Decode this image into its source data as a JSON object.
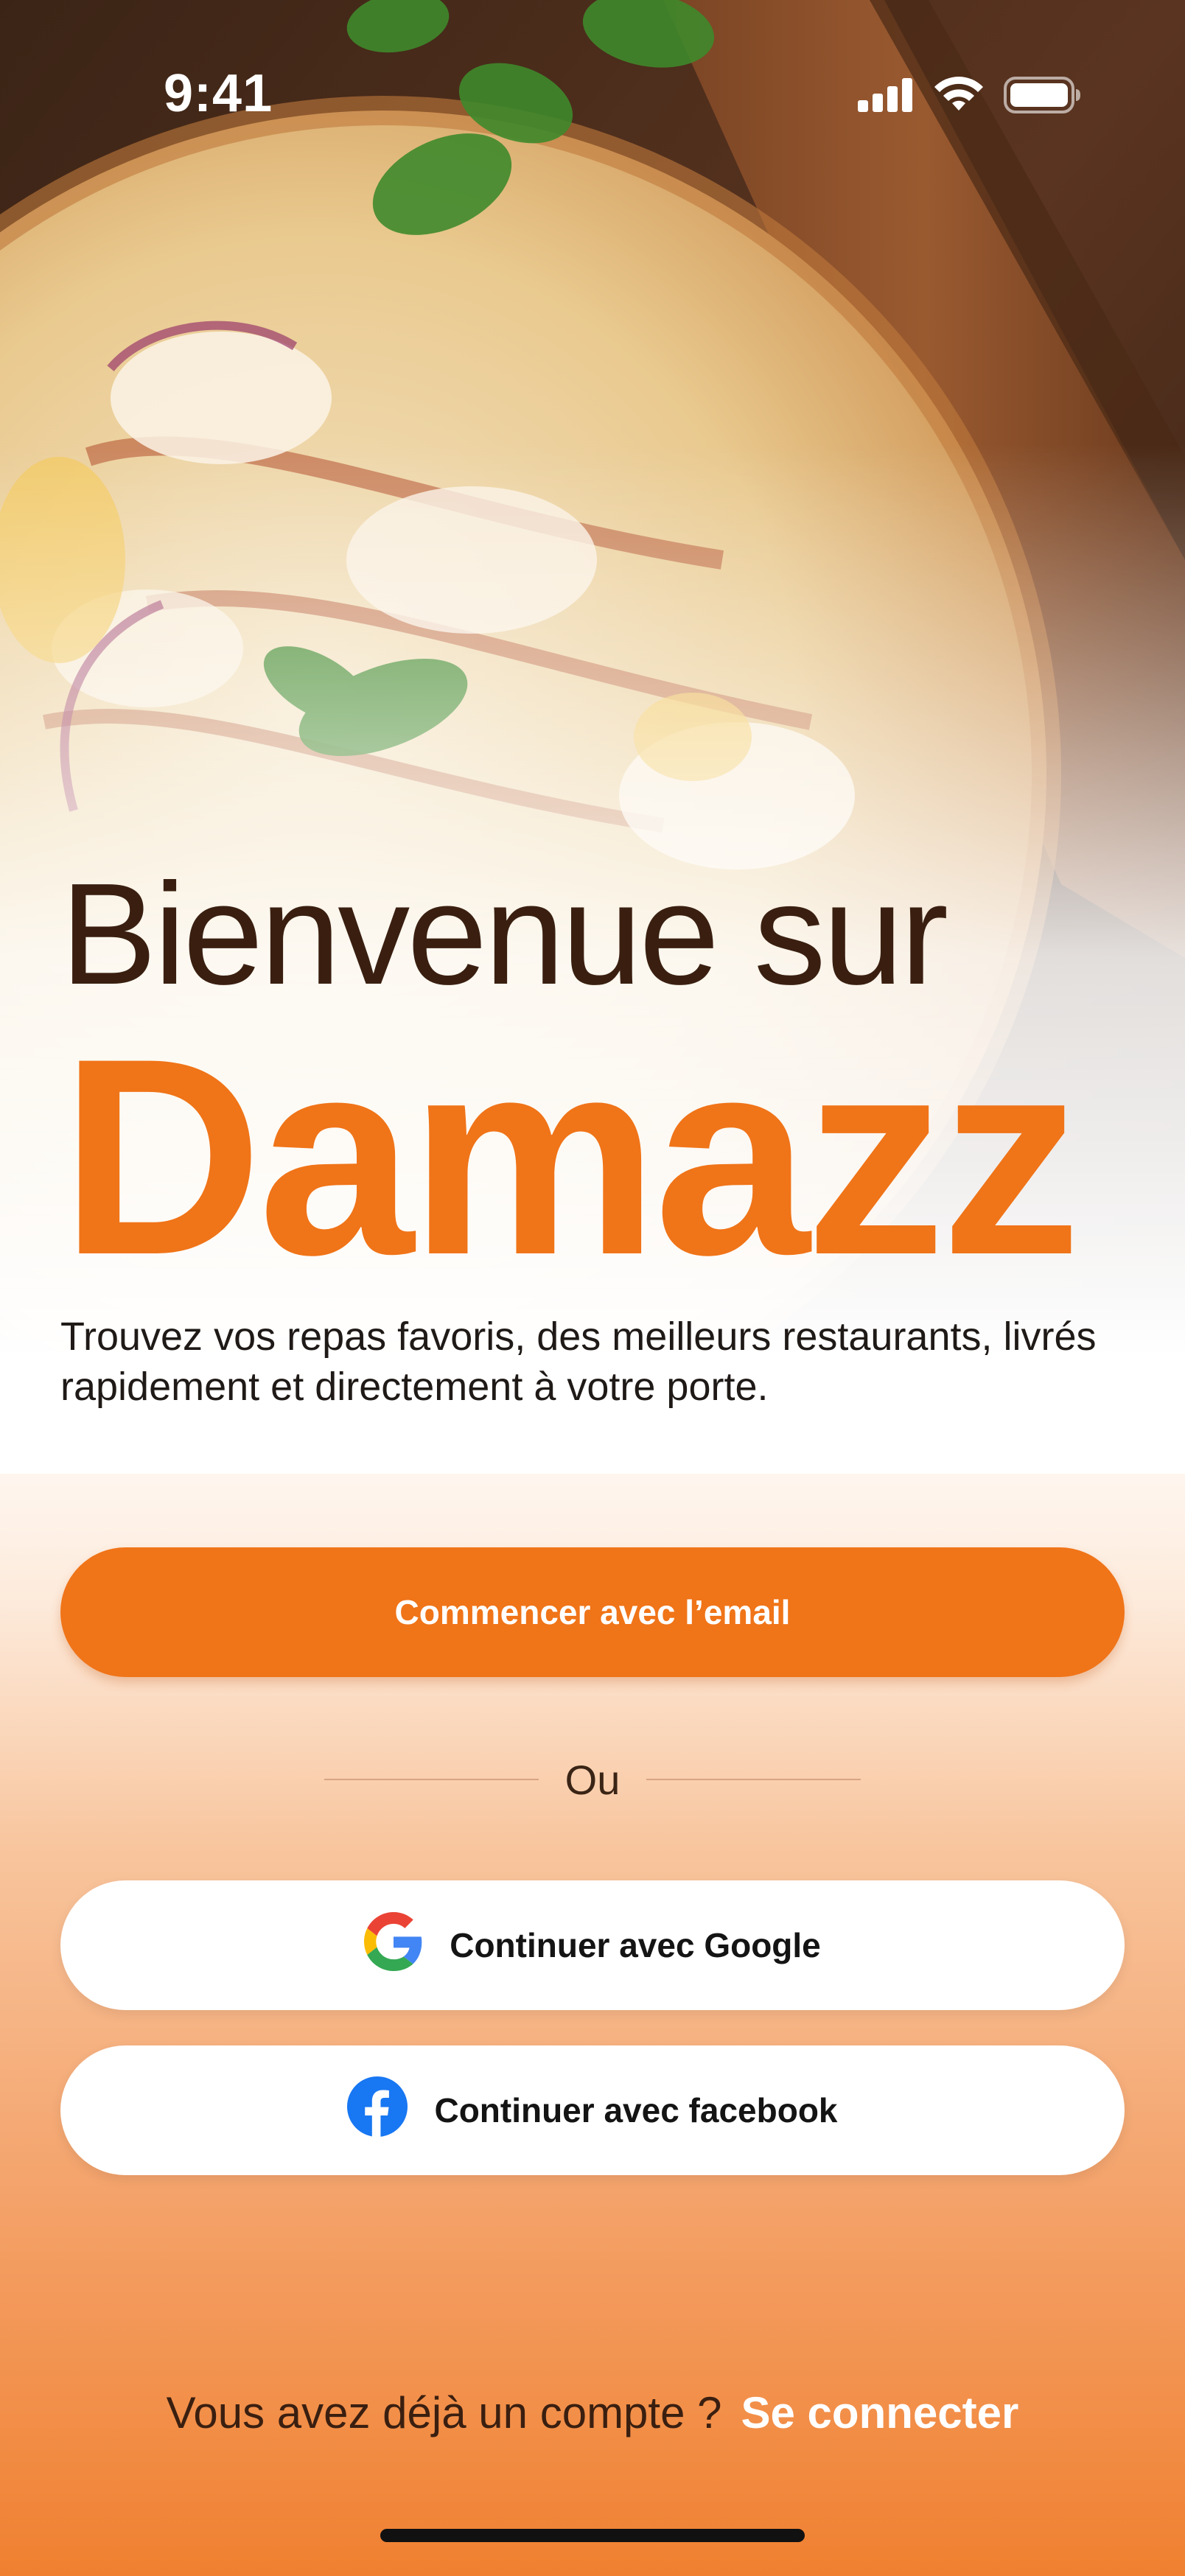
{
  "status_bar": {
    "time": "9:41",
    "icons": [
      "signal-icon",
      "wifi-icon",
      "battery-icon"
    ]
  },
  "hero": {
    "image": "pizza-on-wooden-board-photo"
  },
  "headline": {
    "line1": "Bienvenue sur",
    "brand": "Damazz"
  },
  "subtitle": "Trouvez vos repas favoris, des meilleurs restaurants, livrés rapidement et directement à votre porte.",
  "actions": {
    "email_label": "Commencer avec l’email",
    "divider_label": "Ou",
    "google_label": "Continuer avec Google",
    "facebook_label": "Continuer avec facebook"
  },
  "footer": {
    "question": "Vous avez déjà un compte ?",
    "login_label": "Se connecter"
  },
  "colors": {
    "brand_orange": "#F07418",
    "heading_brown": "#3A1F10",
    "white": "#FFFFFF",
    "facebook_blue": "#1877F2"
  }
}
